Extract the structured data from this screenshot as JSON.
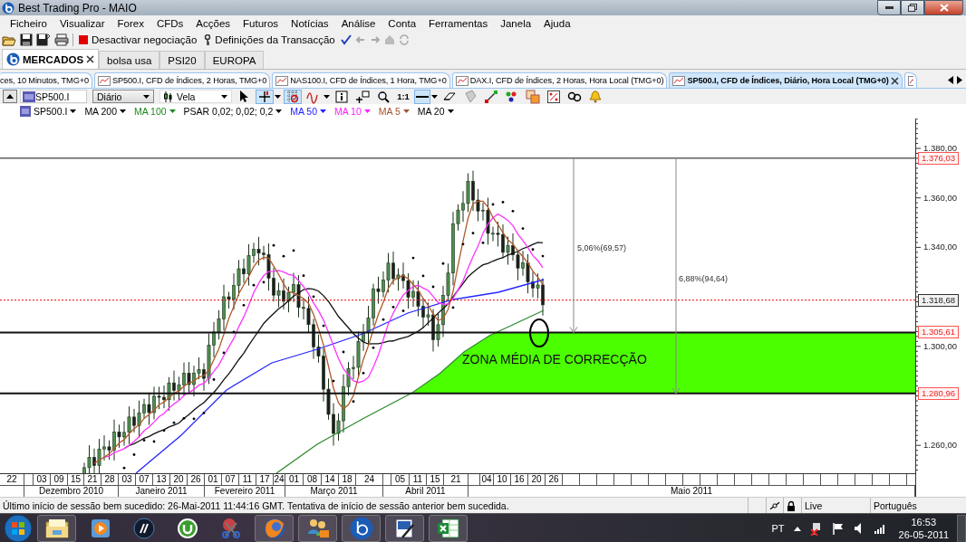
{
  "window": {
    "title": "Best Trading Pro - MAIO"
  },
  "menu": [
    "Ficheiro",
    "Visualizar",
    "Forex",
    "CFDs",
    "Acções",
    "Futuros",
    "Notícias",
    "Análise",
    "Conta",
    "Ferramentas",
    "Janela",
    "Ajuda"
  ],
  "toolbar": {
    "disable_trading": "Desactivar negociação",
    "trade_settings": "Definições da Transacção"
  },
  "workspace_tabs": [
    {
      "label": "MERCADOS",
      "selected": true
    },
    {
      "label": "bolsa usa",
      "selected": false
    },
    {
      "label": "PSI20",
      "selected": false
    },
    {
      "label": "EUROPA",
      "selected": false
    }
  ],
  "chart_tabs": [
    {
      "label": "ces, 10 Minutos, TMG+0",
      "selected": false
    },
    {
      "label": "SP500.I, CFD de Índices, 2 Horas, TMG+0",
      "selected": false
    },
    {
      "label": "NAS100.I, CFD de Índices, 1 Hora, TMG+0",
      "selected": false
    },
    {
      "label": "DAX.I, CFD de Índices, 2 Horas, Hora Local (TMG+0)",
      "selected": false
    },
    {
      "label": "SP500.I, CFD de Índices, Diário, Hora Local (TMG+0)",
      "selected": true
    }
  ],
  "chart_toolbar": {
    "symbol": "SP500.I",
    "period": "Diário",
    "chart_type": "Vela",
    "tools": [
      {
        "kind": "cursor",
        "selected": false
      },
      {
        "kind": "crosshair",
        "selected": true,
        "menu": true
      },
      {
        "kind": "grid",
        "selected": true
      },
      {
        "kind": "indicator",
        "selected": false,
        "menu": true
      },
      {
        "kind": "info",
        "selected": false
      },
      {
        "kind": "annotate",
        "selected": false
      },
      {
        "kind": "zoom",
        "selected": false
      },
      {
        "kind": "one_to_one",
        "selected": false,
        "label": "1:1"
      },
      {
        "kind": "line",
        "selected": true,
        "menu": true
      },
      {
        "kind": "eraser",
        "selected": false
      },
      {
        "kind": "stamp",
        "selected": false
      },
      {
        "kind": "arrow",
        "selected": false
      },
      {
        "kind": "multi",
        "selected": false
      },
      {
        "kind": "template",
        "selected": false
      },
      {
        "kind": "percent",
        "selected": false
      },
      {
        "kind": "link",
        "selected": false
      },
      {
        "kind": "alert",
        "selected": false
      }
    ]
  },
  "legend": [
    {
      "label": "SP500.I",
      "color": "#000000"
    },
    {
      "label": "MA 200",
      "color": "#000000"
    },
    {
      "label": "MA 100",
      "color": "#1a8a1a"
    },
    {
      "label": "PSAR 0,02; 0,02; 0,2",
      "color": "#000000"
    },
    {
      "label": "MA 50",
      "color": "#2020ff"
    },
    {
      "label": "MA 10",
      "color": "#ff20ff"
    },
    {
      "label": "MA 5",
      "color": "#a0522d"
    },
    {
      "label": "MA 20",
      "color": "#000000"
    }
  ],
  "chart": {
    "y_axis_labels": [
      "1.380,00",
      "1.360,00",
      "1.340,00",
      "1.300,00",
      "1.260,00"
    ],
    "price_tags": [
      {
        "label": "1.376,03",
        "kind": "level"
      },
      {
        "label": "1.318,68",
        "kind": "current"
      },
      {
        "label": "1.305,61",
        "kind": "level"
      },
      {
        "label": "1.280,96",
        "kind": "level"
      }
    ],
    "measurements": [
      "5,06%(69,57)",
      "6,88%(94,64)"
    ],
    "zone_label": "ZONA MÉDIA DE CORRECÇÃO",
    "day_labels": [
      "22",
      "03",
      "09",
      "15",
      "21",
      "28",
      "03",
      "07",
      "13",
      "20",
      "26",
      "01",
      "07",
      "11",
      "17",
      "24",
      "01",
      "08",
      "14",
      "18",
      "24",
      "05",
      "11",
      "15",
      "21",
      "04",
      "10",
      "16",
      "20",
      "26"
    ],
    "month_labels": [
      "Dezembro 2010",
      "Janeiro 2011",
      "Fevereiro 2011",
      "Março 2011",
      "Abril 2011",
      "Maio 2011"
    ]
  },
  "status_bar": {
    "message": "Último início de sessão bem sucedido: 26-Mai-2011 11:44:16 GMT. Tentativa de início de sessão anterior bem sucedida.",
    "mode": "Live",
    "language": "Português"
  },
  "taskbar": {
    "language": "PT",
    "time": "16:53",
    "date": "26-05-2011"
  }
}
